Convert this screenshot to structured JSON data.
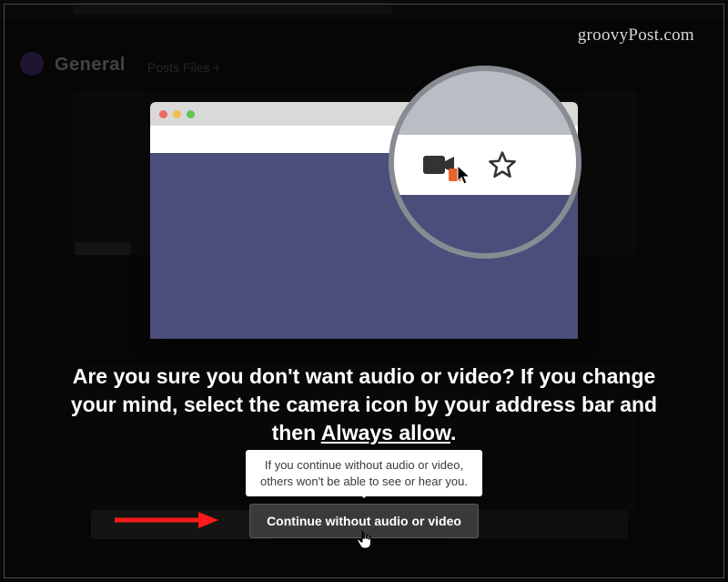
{
  "watermark": {
    "text_pre": "groovy",
    "text_post": "Post.com"
  },
  "background": {
    "channel_name": "General",
    "tab_text": "Posts  Files  +"
  },
  "illustration": {
    "camera_icon_name": "camera-icon",
    "star_icon_name": "bookmark-star-icon"
  },
  "headline": {
    "line1_pre": "Are you sure you don't want audio or video? If you change your mind, select the camera icon by your address bar and then ",
    "always_allow": "Always allow",
    "line1_post": "."
  },
  "tooltip": {
    "line1": "If you continue without audio or video,",
    "line2": "others won't be able to see or hear you."
  },
  "button": {
    "continue_label": "Continue without audio or video"
  }
}
